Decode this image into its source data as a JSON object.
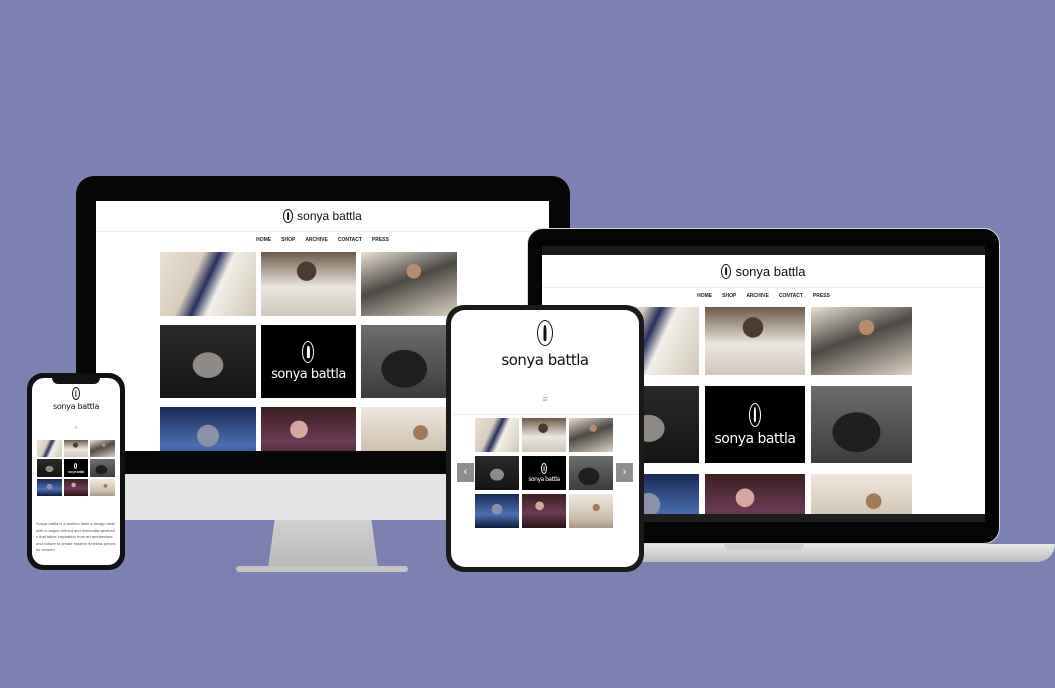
{
  "brand": "sonya battla",
  "nav": [
    "HOME",
    "SHOP",
    "ARCHIVE",
    "CONTACT",
    "PRESS"
  ],
  "tiles": [
    {
      "style": "photo",
      "label": "gallery-photo-embroidered-gown"
    },
    {
      "style": "photo",
      "label": "gallery-photo-white-blouse"
    },
    {
      "style": "photo",
      "label": "gallery-photo-grey-cape"
    },
    {
      "style": "photo",
      "label": "gallery-photo-bw-fringe"
    },
    {
      "style": "logo",
      "label": "gallery-logo-tile"
    },
    {
      "style": "photo",
      "label": "gallery-photo-dark-dress"
    },
    {
      "style": "photo",
      "label": "gallery-photo-blue-portrait"
    },
    {
      "style": "photo",
      "label": "gallery-photo-purple-dress"
    },
    {
      "style": "photo",
      "label": "gallery-photo-beige-portrait"
    }
  ],
  "tablet": {
    "menu_icon": "≡",
    "prev": "‹",
    "next": "›"
  },
  "phone": {
    "menu_icon": "≡",
    "body_text": "Sonya battla is a fashion label a design label with a unique refined and minimalist aesthetic that takes inspiration from art architecture and culture to create modern timeless pieces for women"
  }
}
